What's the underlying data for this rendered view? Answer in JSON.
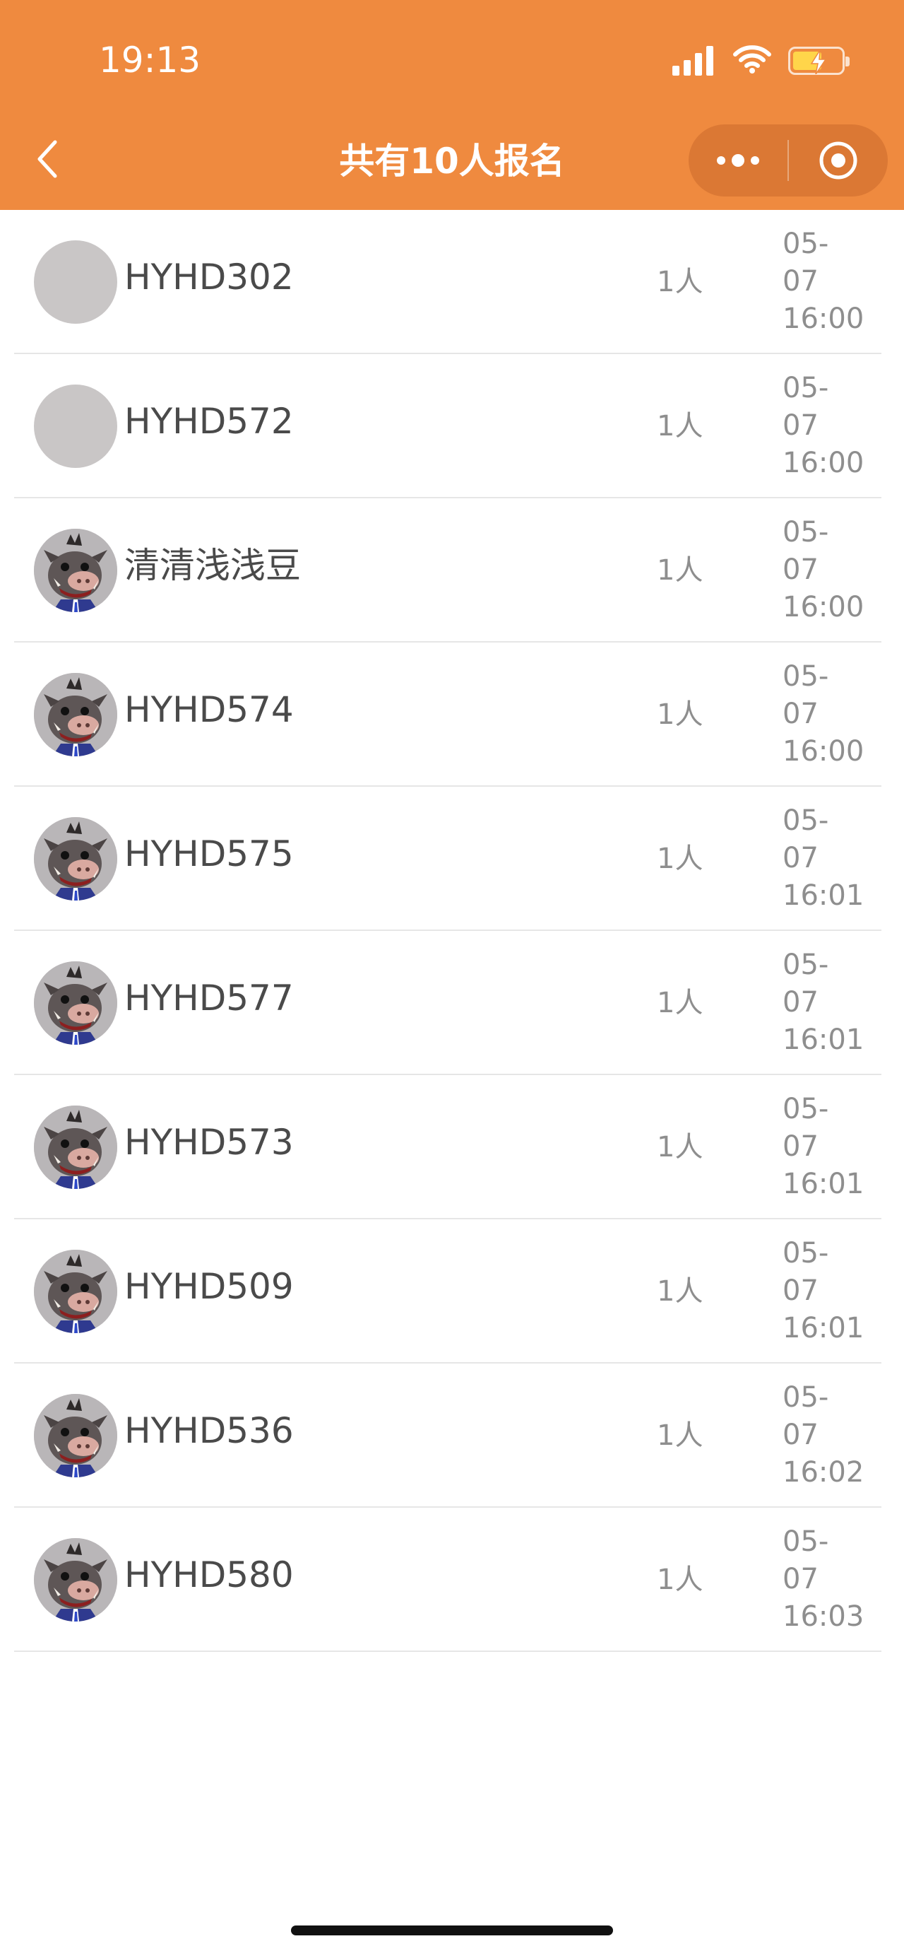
{
  "status_bar": {
    "time": "19:13"
  },
  "nav": {
    "title": "共有10人报名",
    "back_icon": "chevron-left-icon",
    "more_icon": "more-dots-icon",
    "close_icon": "target-close-icon",
    "header_color": "#EF8A3F"
  },
  "entries": [
    {
      "name": "HYHD302",
      "count": "1人",
      "date_month": "05-",
      "date_day": "07",
      "time": "16:00",
      "avatar": "blank"
    },
    {
      "name": "HYHD572",
      "count": "1人",
      "date_month": "05-",
      "date_day": "07",
      "time": "16:00",
      "avatar": "blank"
    },
    {
      "name": "清清浅浅豆",
      "count": "1人",
      "date_month": "05-",
      "date_day": "07",
      "time": "16:00",
      "avatar": "boar"
    },
    {
      "name": "HYHD574",
      "count": "1人",
      "date_month": "05-",
      "date_day": "07",
      "time": "16:00",
      "avatar": "boar"
    },
    {
      "name": "HYHD575",
      "count": "1人",
      "date_month": "05-",
      "date_day": "07",
      "time": "16:01",
      "avatar": "boar"
    },
    {
      "name": "HYHD577",
      "count": "1人",
      "date_month": "05-",
      "date_day": "07",
      "time": "16:01",
      "avatar": "boar"
    },
    {
      "name": "HYHD573",
      "count": "1人",
      "date_month": "05-",
      "date_day": "07",
      "time": "16:01",
      "avatar": "boar"
    },
    {
      "name": "HYHD509",
      "count": "1人",
      "date_month": "05-",
      "date_day": "07",
      "time": "16:01",
      "avatar": "boar"
    },
    {
      "name": "HYHD536",
      "count": "1人",
      "date_month": "05-",
      "date_day": "07",
      "time": "16:02",
      "avatar": "boar"
    },
    {
      "name": "HYHD580",
      "count": "1人",
      "date_month": "05-",
      "date_day": "07",
      "time": "16:03",
      "avatar": "boar"
    }
  ]
}
